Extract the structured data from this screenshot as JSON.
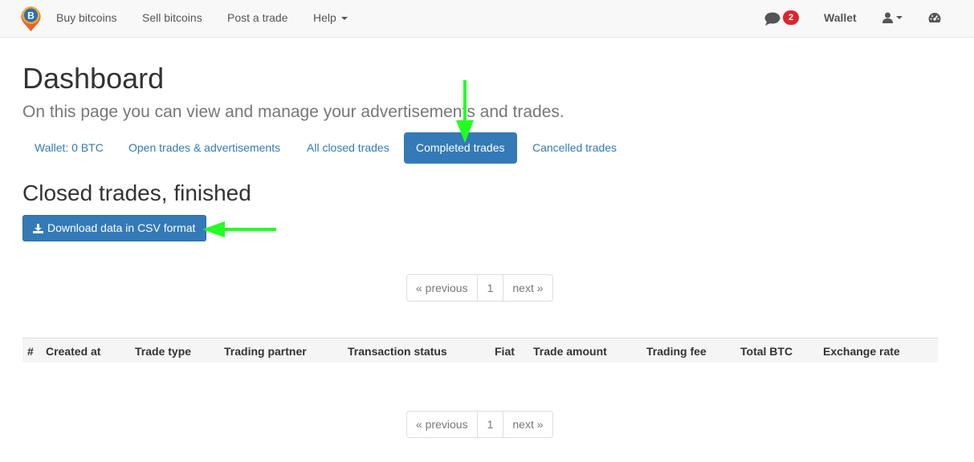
{
  "navbar": {
    "links": [
      "Buy bitcoins",
      "Sell bitcoins",
      "Post a trade",
      "Help"
    ],
    "notification_count": "2",
    "wallet_label": "Wallet"
  },
  "page": {
    "title": "Dashboard",
    "subtitle": "On this page you can view and manage your advertisements and trades."
  },
  "tabs": [
    {
      "label": "Wallet: 0 BTC",
      "active": false
    },
    {
      "label": "Open trades & advertisements",
      "active": false
    },
    {
      "label": "All closed trades",
      "active": false
    },
    {
      "label": "Completed trades",
      "active": true
    },
    {
      "label": "Cancelled trades",
      "active": false
    }
  ],
  "section": {
    "title": "Closed trades, finished",
    "download_label": "Download data in CSV format"
  },
  "pagination": {
    "previous": "« previous",
    "page": "1",
    "next": "next »"
  },
  "table": {
    "headers": [
      "#",
      "Created at",
      "Trade type",
      "Trading partner",
      "Transaction status",
      "Fiat",
      "Trade amount",
      "Trading fee",
      "Total BTC",
      "Exchange rate"
    ]
  },
  "colors": {
    "primary": "#337ab7",
    "annotation_arrow": "#22ff22",
    "badge": "#d9262f"
  }
}
